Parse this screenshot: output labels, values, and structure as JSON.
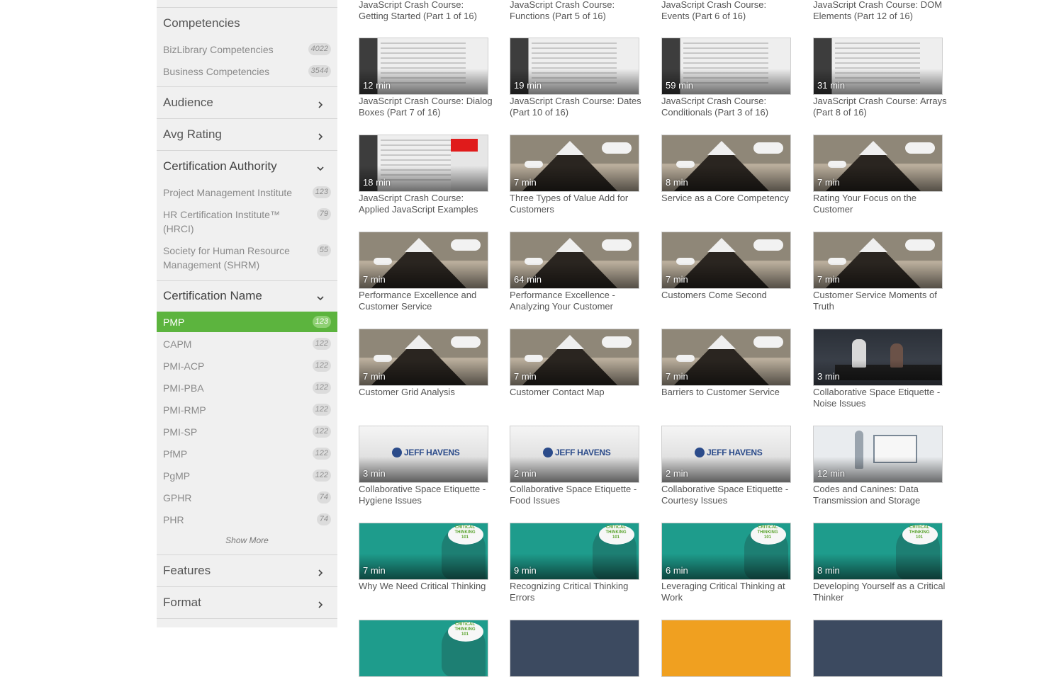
{
  "sidebar": {
    "competencies": {
      "title": "Competencies",
      "items": [
        {
          "label": "BizLibrary Competencies",
          "count": "4022"
        },
        {
          "label": "Business Competencies",
          "count": "3544"
        }
      ]
    },
    "audience": {
      "title": "Audience",
      "expanded": false
    },
    "avg_rating": {
      "title": "Avg Rating",
      "expanded": false
    },
    "cert_authority": {
      "title": "Certification Authority",
      "expanded": true,
      "items": [
        {
          "label": "Project Management Institute",
          "count": "123"
        },
        {
          "label": "HR Certification Institute™ (HRCI)",
          "count": "79"
        },
        {
          "label": "Society for Human Resource Management (SHRM)",
          "count": "55"
        }
      ]
    },
    "cert_name": {
      "title": "Certification Name",
      "expanded": true,
      "items": [
        {
          "label": "PMP",
          "count": "123",
          "selected": true
        },
        {
          "label": "CAPM",
          "count": "122"
        },
        {
          "label": "PMI-ACP",
          "count": "122"
        },
        {
          "label": "PMI-PBA",
          "count": "122"
        },
        {
          "label": "PMI-RMP",
          "count": "122"
        },
        {
          "label": "PMI-SP",
          "count": "122"
        },
        {
          "label": "PfMP",
          "count": "122"
        },
        {
          "label": "PgMP",
          "count": "122"
        },
        {
          "label": "GPHR",
          "count": "74"
        },
        {
          "label": "PHR",
          "count": "74"
        }
      ],
      "show_more": "Show More"
    },
    "features": {
      "title": "Features",
      "expanded": false
    },
    "format": {
      "title": "Format",
      "expanded": false
    },
    "selected_color": "#5cb43e"
  },
  "grid": {
    "top_titles": [
      "JavaScript Crash Course: Getting Started (Part 1 of 16)",
      "JavaScript Crash Course: Functions (Part 5 of 16)",
      "JavaScript Crash Course: Events (Part 6 of 16)",
      "JavaScript Crash Course: DOM Elements (Part 12 of 16)"
    ],
    "rows": [
      [
        {
          "dur": "12 min",
          "title": "JavaScript Crash Course: Dialog Boxes (Part 7 of 16)",
          "thumb": "code"
        },
        {
          "dur": "19 min",
          "title": "JavaScript Crash Course: Dates (Part 10 of 16)",
          "thumb": "code"
        },
        {
          "dur": "59 min",
          "title": "JavaScript Crash Course: Conditionals (Part 3 of 16)",
          "thumb": "code"
        },
        {
          "dur": "31 min",
          "title": "JavaScript Crash Course: Arrays (Part 8 of 16)",
          "thumb": "code"
        }
      ],
      [
        {
          "dur": "18 min",
          "title": "JavaScript Crash Course: Applied JavaScript Examples",
          "thumb": "code-red"
        },
        {
          "dur": "7 min",
          "title": "Three Types of Value Add for Customers",
          "thumb": "mountain"
        },
        {
          "dur": "8 min",
          "title": "Service as a Core Competency",
          "thumb": "mountain"
        },
        {
          "dur": "7 min",
          "title": "Rating Your Focus on the Customer",
          "thumb": "mountain"
        }
      ],
      [
        {
          "dur": "7 min",
          "title": "Performance Excellence and Customer Service",
          "thumb": "mountain"
        },
        {
          "dur": "64 min",
          "title": "Performance Excellence - Analyzing Your Customer",
          "thumb": "mountain"
        },
        {
          "dur": "7 min",
          "title": "Customers Come Second",
          "thumb": "mountain"
        },
        {
          "dur": "7 min",
          "title": "Customer Service Moments of Truth",
          "thumb": "mountain"
        }
      ],
      [
        {
          "dur": "7 min",
          "title": "Customer Grid Analysis",
          "thumb": "mountain"
        },
        {
          "dur": "7 min",
          "title": "Customer Contact Map",
          "thumb": "mountain"
        },
        {
          "dur": "7 min",
          "title": "Barriers to Customer Service",
          "thumb": "mountain"
        },
        {
          "dur": "3 min",
          "title": "Collaborative Space Etiquette - Noise Issues",
          "thumb": "office"
        }
      ],
      [
        {
          "dur": "3 min",
          "title": "Collaborative Space Etiquette - Hygiene Issues",
          "thumb": "havens"
        },
        {
          "dur": "2 min",
          "title": "Collaborative Space Etiquette - Food Issues",
          "thumb": "havens"
        },
        {
          "dur": "2 min",
          "title": "Collaborative Space Etiquette - Courtesy Issues",
          "thumb": "havens"
        },
        {
          "dur": "12 min",
          "title": "Codes and Canines: Data Transmission and Storage",
          "thumb": "canine"
        }
      ],
      [
        {
          "dur": "7 min",
          "title": "Why We Need Critical Thinking",
          "thumb": "teal"
        },
        {
          "dur": "9 min",
          "title": "Recognizing Critical Thinking Errors",
          "thumb": "teal"
        },
        {
          "dur": "6 min",
          "title": "Leveraging Critical Thinking at Work",
          "thumb": "teal"
        },
        {
          "dur": "8 min",
          "title": "Developing Yourself as a Critical Thinker",
          "thumb": "teal"
        }
      ]
    ],
    "partial_row_thumbs": [
      "teal",
      "darkblue",
      "orange",
      "darkblue"
    ],
    "logo_text": "JEFF HAVENS",
    "badge_text": "CRITICAL THINKING 101"
  }
}
